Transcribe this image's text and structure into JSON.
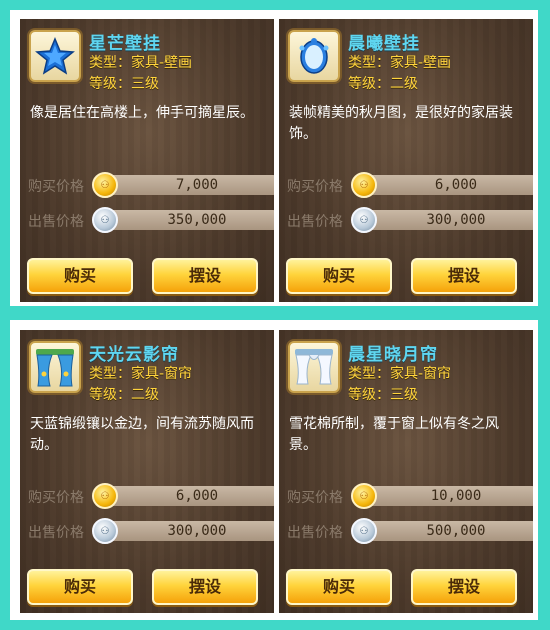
{
  "labels": {
    "buy_price": "购买价格",
    "sell_price": "出售价格",
    "buy_button": "购买",
    "place_button": "摆设"
  },
  "items": [
    {
      "name": "星芒壁挂",
      "type": "类型：家具-壁画",
      "level": "等级：三级",
      "description": "像是居住在高楼上，伸手可摘星辰。",
      "buy_price": "7,000",
      "sell_price": "350,000",
      "icon": "star-wall-hanging-icon"
    },
    {
      "name": "晨曦壁挂",
      "type": "类型：家具-壁画",
      "level": "等级：二级",
      "description": "装帧精美的秋月图，是很好的家居装饰。",
      "buy_price": "6,000",
      "sell_price": "300,000",
      "icon": "mirror-wall-hanging-icon"
    },
    {
      "name": "天光云影帘",
      "type": "类型：家具-窗帘",
      "level": "等级：二级",
      "description": "天蓝锦缎镶以金边，间有流苏随风而动。",
      "buy_price": "6,000",
      "sell_price": "300,000",
      "icon": "blue-curtain-icon"
    },
    {
      "name": "晨星晓月帘",
      "type": "类型：家具-窗帘",
      "level": "等级：三级",
      "description": "雪花棉所制，覆于窗上似有冬之风景。",
      "buy_price": "10,000",
      "sell_price": "500,000",
      "icon": "white-curtain-icon"
    }
  ],
  "colors": {
    "background": "#40d8c8",
    "name": "#5fd6f0",
    "meta": "#ffd43c",
    "button": "#ffd43c"
  }
}
